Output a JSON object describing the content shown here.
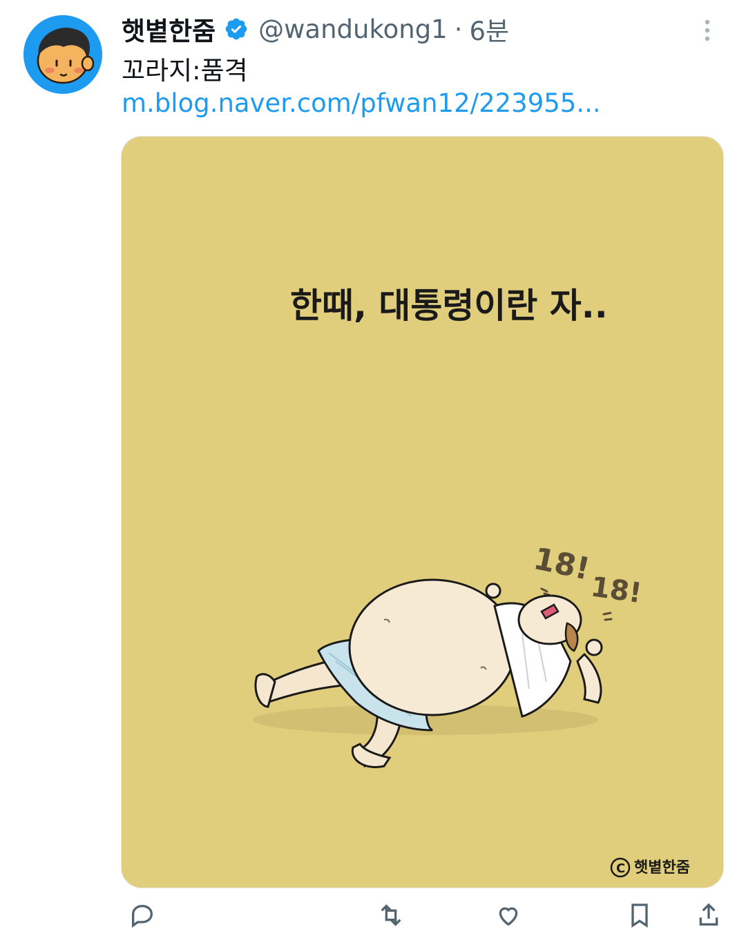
{
  "tweet": {
    "author": {
      "display_name": "햇볕한줌",
      "handle": "@wandukong1",
      "verified": true,
      "avatar_icon": "cartoon-face-avatar"
    },
    "separator": "·",
    "timestamp": "6분",
    "text": "꼬라지:품격",
    "link": "m.blog.naver.com/pfwan12/223955..."
  },
  "comic": {
    "caption": "한때, 대통령이란 자..",
    "exclamation_1": "18!",
    "exclamation_2": "18!",
    "signature": "햇볕한줌",
    "background_color": "#e1ce7d"
  },
  "colors": {
    "accent": "#1d9bf0",
    "text_primary": "#0f1419",
    "text_secondary": "#536471"
  },
  "actions": {
    "icons": [
      "reply-icon",
      "retweet-icon",
      "like-icon",
      "views-icon",
      "bookmark-icon",
      "share-icon"
    ]
  }
}
